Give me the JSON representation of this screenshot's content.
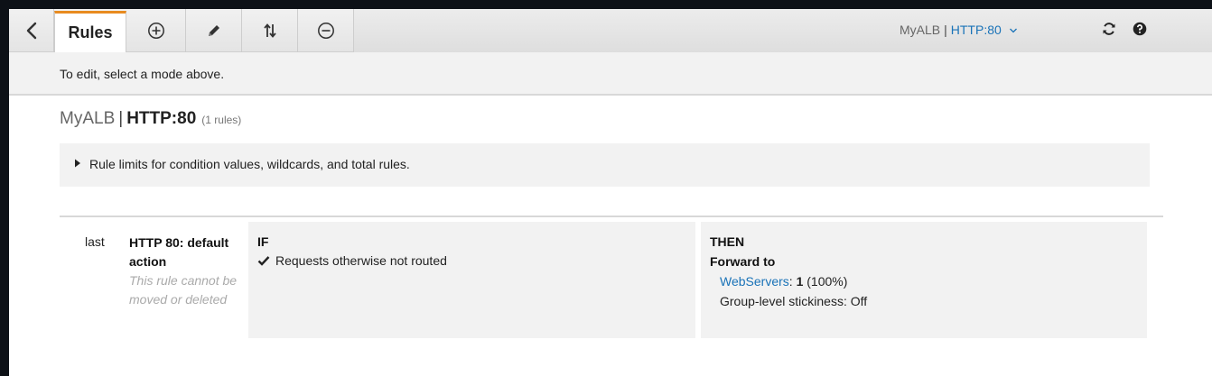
{
  "toolbar": {
    "tab_label": "Rules",
    "icons": {
      "back": "chevron-left-icon",
      "add": "plus-circle-icon",
      "edit": "pencil-icon",
      "reorder": "sort-arrows-icon",
      "delete": "minus-circle-icon",
      "refresh": "refresh-icon",
      "help": "help-icon"
    },
    "selector": {
      "load_balancer": "MyALB",
      "separator": "|",
      "listener": "HTTP:80",
      "icon": "chevron-down-icon"
    }
  },
  "info_bar": {
    "text": "To edit, select a mode above."
  },
  "heading": {
    "load_balancer": "MyALB",
    "separator": "|",
    "listener": "HTTP:80",
    "count": "(1 rules)"
  },
  "limits": {
    "label": "Rule limits for condition values, wildcards, and total rules.",
    "icon": "caret-right-icon"
  },
  "rule": {
    "priority": "last",
    "name": "HTTP 80: default action",
    "note": "This rule cannot be moved or deleted",
    "if_title": "IF",
    "condition": "Requests otherwise not routed",
    "then_title": "THEN",
    "action": "Forward to",
    "target_group": "WebServers",
    "weight_sep": ":",
    "weight": "1",
    "weight_pct": "(100%)",
    "stickiness": "Group-level stickiness: Off"
  },
  "colors": {
    "accent_tab": "#e88b20",
    "link": "#1a73b8",
    "panel_bg": "#f2f2f2"
  }
}
